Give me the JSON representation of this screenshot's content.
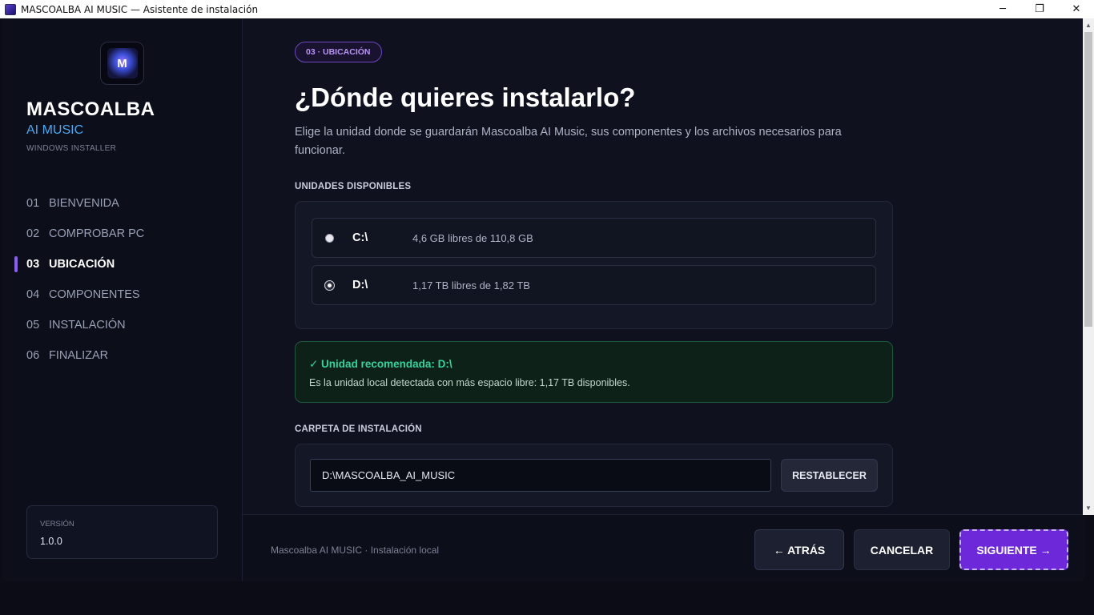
{
  "window": {
    "title": "MASCOALBA AI MUSIC — Asistente de instalación",
    "minimize_glyph": "─",
    "maximize_glyph": "❐",
    "close_glyph": "✕"
  },
  "sidebar": {
    "logo_text": "M",
    "brand": "MASCOALBA",
    "brand_sub": "AI MUSIC",
    "tag": "WINDOWS INSTALLER",
    "items": [
      {
        "num": "01",
        "label": "BIENVENIDA"
      },
      {
        "num": "02",
        "label": "COMPROBAR PC"
      },
      {
        "num": "03",
        "label": "UBICACIÓN"
      },
      {
        "num": "04",
        "label": "COMPONENTES"
      },
      {
        "num": "05",
        "label": "INSTALACIÓN"
      },
      {
        "num": "06",
        "label": "FINALIZAR"
      }
    ],
    "active_index": 2,
    "version_label": "VERSIÓN",
    "version_value": "1.0.0"
  },
  "main": {
    "step_pill": "03 · UBICACIÓN",
    "title": "¿Dónde quieres instalarlo?",
    "description": "Elige la unidad donde se guardarán Mascoalba AI Music, sus componentes y los archivos necesarios para funcionar.",
    "drives_label": "UNIDADES DISPONIBLES",
    "drives": [
      {
        "letter": "C:\\",
        "info": "4,6 GB libres de 110,8 GB",
        "selected": false
      },
      {
        "letter": "D:\\",
        "info": "1,17 TB libres de 1,82 TB",
        "selected": true
      }
    ],
    "recommendation_title": "✓ Unidad recomendada: D:\\",
    "recommendation_text": "Es la unidad local detectada con más espacio libre: 1,17 TB disponibles.",
    "folder_label": "CARPETA DE INSTALACIÓN",
    "folder_value": "D:\\MASCOALBA_AI_MUSIC",
    "reset_label": "RESTABLECER"
  },
  "scrollbar": {
    "up_glyph": "▲",
    "down_glyph": "▼"
  },
  "footer": {
    "text": "Mascoalba AI MUSIC · Instalación local",
    "back_label": "← ATRÁS",
    "cancel_label": "CANCELAR",
    "next_label": "SIGUIENTE →"
  },
  "colors": {
    "accent": "#8b5cf6",
    "primary_button": "#6d28d9",
    "success": "#34d399",
    "brand_sub": "#4aa8f0"
  }
}
